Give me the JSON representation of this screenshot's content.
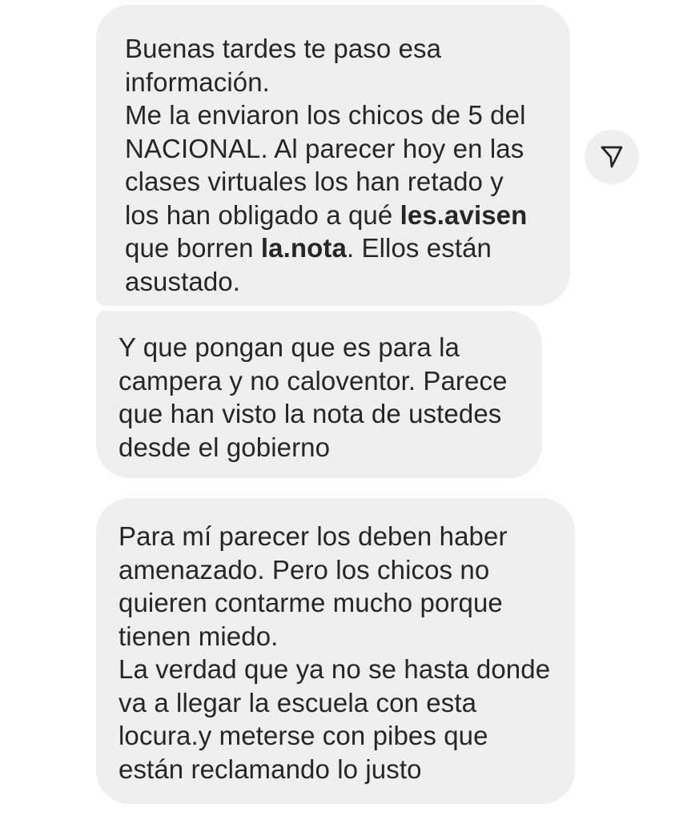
{
  "messages": [
    {
      "lines": [
        [
          {
            "text": "Buenas tardes te paso esa"
          }
        ],
        [
          {
            "text": "información."
          }
        ],
        [
          {
            "text": "Me la enviaron los chicos de 5 del"
          }
        ],
        [
          {
            "text": "NACIONAL. Al parecer hoy en las"
          }
        ],
        [
          {
            "text": "clases virtuales los han retado y"
          }
        ],
        [
          {
            "text": "los han obligado a qué "
          },
          {
            "text": "les.avisen",
            "bold": true
          }
        ],
        [
          {
            "text": "que borren "
          },
          {
            "text": "la.nota",
            "bold": true
          },
          {
            "text": ". Ellos están"
          }
        ],
        [
          {
            "text": "asustado."
          }
        ]
      ]
    },
    {
      "lines": [
        [
          {
            "text": "Y que pongan que es para la"
          }
        ],
        [
          {
            "text": "campera y no caloventor. Parece"
          }
        ],
        [
          {
            "text": "que han visto la nota de ustedes"
          }
        ],
        [
          {
            "text": "desde el gobierno"
          }
        ]
      ]
    },
    {
      "lines": [
        [
          {
            "text": "Para mí parecer los deben haber"
          }
        ],
        [
          {
            "text": "amenazado. Pero los chicos no"
          }
        ],
        [
          {
            "text": "quieren contarme mucho porque"
          }
        ],
        [
          {
            "text": "tienen miedo."
          }
        ],
        [
          {
            "text": "La verdad que ya no se hasta donde"
          }
        ],
        [
          {
            "text": "va a llegar la escuela con esta"
          }
        ],
        [
          {
            "text": "locura.y meterse con pibes que"
          }
        ],
        [
          {
            "text": "están reclamando lo justo"
          }
        ]
      ]
    }
  ],
  "share_button": {
    "icon": "send-icon"
  },
  "colors": {
    "bubble_background": "#efefef",
    "text": "#262626",
    "page_background": "#ffffff"
  }
}
